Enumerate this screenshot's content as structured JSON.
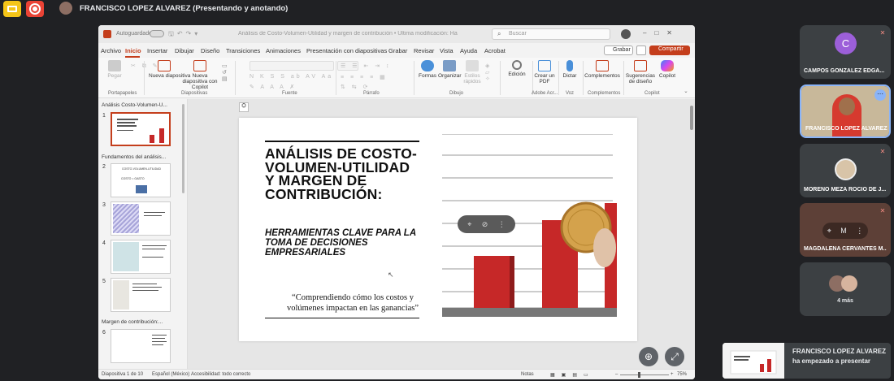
{
  "meet": {
    "presenter_banner": "FRANCISCO LOPEZ ALVAREZ (Presentando y anotando)"
  },
  "ppt": {
    "autosave_label": "Autoguardado",
    "doc_name": "Análisis de Costo-Volumen-Utilidad y margen de contribución • Última modificación: Hace 2 h",
    "search_placeholder": "Buscar",
    "menu": [
      "Archivo",
      "Inicio",
      "Insertar",
      "Dibujar",
      "Diseño",
      "Transiciones",
      "Animaciones",
      "Presentación con diapositivas",
      "Grabar",
      "Revisar",
      "Vista",
      "Ayuda",
      "Acrobat"
    ],
    "grabar_label": "Grabar",
    "share_label": "Compartir",
    "ribbon": {
      "pegar": "Pegar",
      "nueva_diapositiva": "Nueva diapositiva",
      "nueva_copilot": "Nueva diapositiva con Copilot",
      "formas": "Formas",
      "organizar": "Organizar",
      "estilos_rapidos": "Estilos rápidos",
      "edicion": "Edición",
      "crear_pdf": "Crear un PDF",
      "dictar": "Dictar",
      "complementos": "Complementos",
      "sugerencias": "Sugerencias de diseño",
      "copilot": "Copilot"
    },
    "groups": {
      "portapapeles": "Portapapeles",
      "diapositivas": "Diapositivas",
      "fuente": "Fuente",
      "parrafo": "Párrafo",
      "dibujo": "Dibujo",
      "adobe": "Adobe Acr...",
      "voz": "Voz",
      "complementos": "Complementos",
      "copilot": "Copilot"
    },
    "sections": {
      "s1": "Análisis Costo-Volumen-U...",
      "s2": "Fundamentos del análisis...",
      "s3": "Margen de contribución:..."
    },
    "thumb_numbers": [
      "1",
      "2",
      "3",
      "4",
      "5",
      "6"
    ],
    "thumb2_title": "COSTO-VOLUMEN-UTILIDAD",
    "thumb2_row": "COSTO   =   GASTO",
    "slide": {
      "title": "ANÁLISIS DE COSTO-VOLUMEN-UTILIDAD Y MARGEN DE CONTRIBUCIÓN:",
      "subtitle": "HERRAMIENTAS CLAVE PARA LA TOMA DE DECISIONES EMPRESARIALES",
      "quote": "“Comprendiendo cómo los costos y volúmenes impactan en las ganancias”"
    },
    "status": {
      "slide_count": "Diapositiva 1 de 10",
      "language": "Español (México)",
      "accessibility": "Accesibilidad: todo correcto",
      "notes": "Notas",
      "zoom": "75%"
    }
  },
  "participants": [
    {
      "name": "CAMPOS GONZALEZ EDGA...",
      "initial": "C"
    },
    {
      "name": "FRANCISCO LOPEZ ALVAREZ"
    },
    {
      "name": "MORENO MEZA ROCIO DE J..."
    },
    {
      "name": "MAGDALENA CERVANTES M...",
      "initial": "M"
    }
  ],
  "more_participants": "4 más",
  "toast": {
    "text": "FRANCISCO LOPEZ ALVAREZ ha empezado a presentar"
  },
  "colors": {
    "ppt_accent": "#c43e1c",
    "bar_red": "#c62828",
    "record_red": "#ea4335",
    "avatar_purple": "#9c5fd9"
  }
}
